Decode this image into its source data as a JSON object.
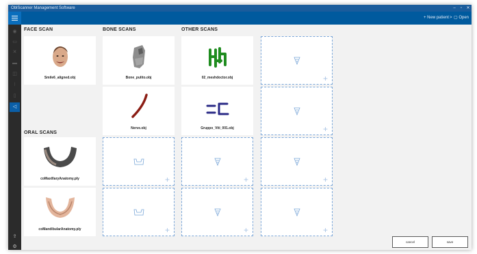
{
  "window": {
    "title": "OblScanner Management Software"
  },
  "toolbar": {
    "new_patient": "+ New patient",
    "separator": ">",
    "open": "Open"
  },
  "sections": {
    "face": "FACE SCAN",
    "bone": "BONE SCANS",
    "other": "OTHER SCANS",
    "oral": "ORAL SCANS"
  },
  "scans": {
    "face": [
      "Smile6_aligned.obj"
    ],
    "bone": [
      "Bone_pulito.obj",
      "Nerve.obj"
    ],
    "other": [
      "02_meshdoctor.obj",
      "Gruppo_Viti_001.obj"
    ],
    "oral": [
      "coMaxillaryAnatomy.ply",
      "coMandibularAnatomy.ply"
    ]
  },
  "footer": {
    "cancel": "cancel",
    "save": "save"
  },
  "colors": {
    "accent": "#005a9e",
    "placeholder": "#7aa6d8"
  },
  "icons": {
    "placeholder": "screw-placeholder-icon",
    "bone_placeholder": "bone-placeholder-icon",
    "add": "plus-icon"
  }
}
